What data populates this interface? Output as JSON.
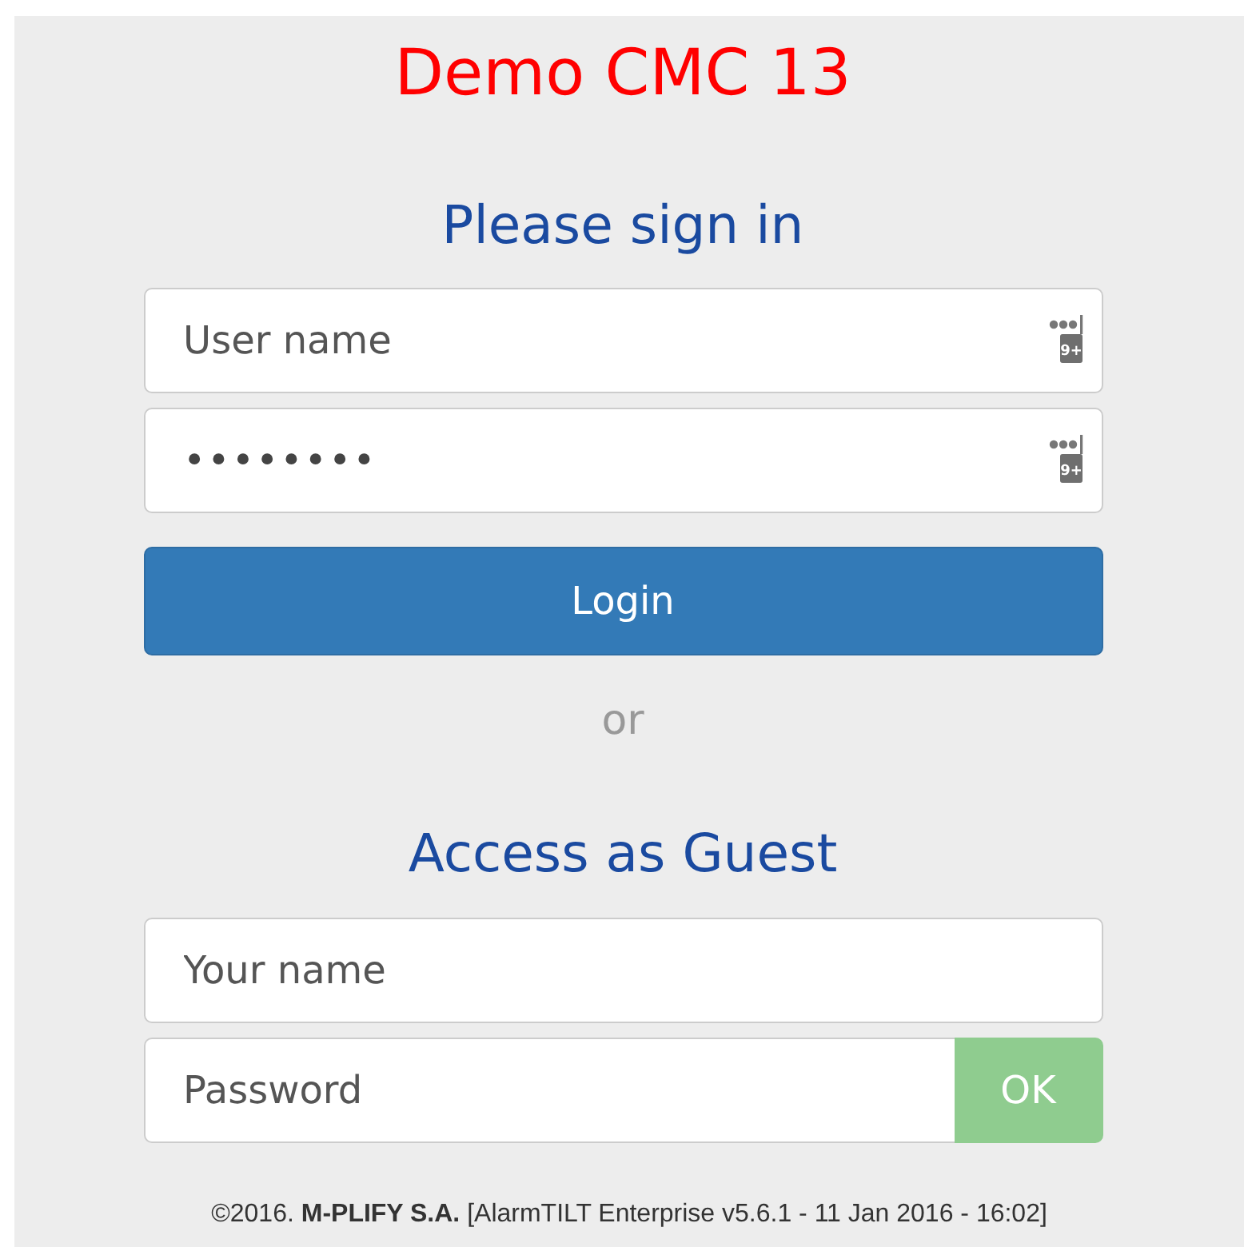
{
  "title": "Demo CMC 13",
  "sign_in": {
    "heading": "Please sign in",
    "fields": [
      {
        "placeholder": "User name",
        "badge": "9+"
      },
      {
        "value": "••••••••",
        "badge": "9+"
      }
    ],
    "button": "Login"
  },
  "separator": "or",
  "guest": {
    "heading": "Access as Guest",
    "name_placeholder": "Your name",
    "password_placeholder": "Password",
    "button": "OK",
    "button_disabled": true
  },
  "footer": {
    "copyright": "©2016.",
    "company": "M-PLIFY S.A.",
    "version": "[AlarmTILT Enterprise v5.6.1 - 11 Jan 2016 - 16:02]"
  }
}
